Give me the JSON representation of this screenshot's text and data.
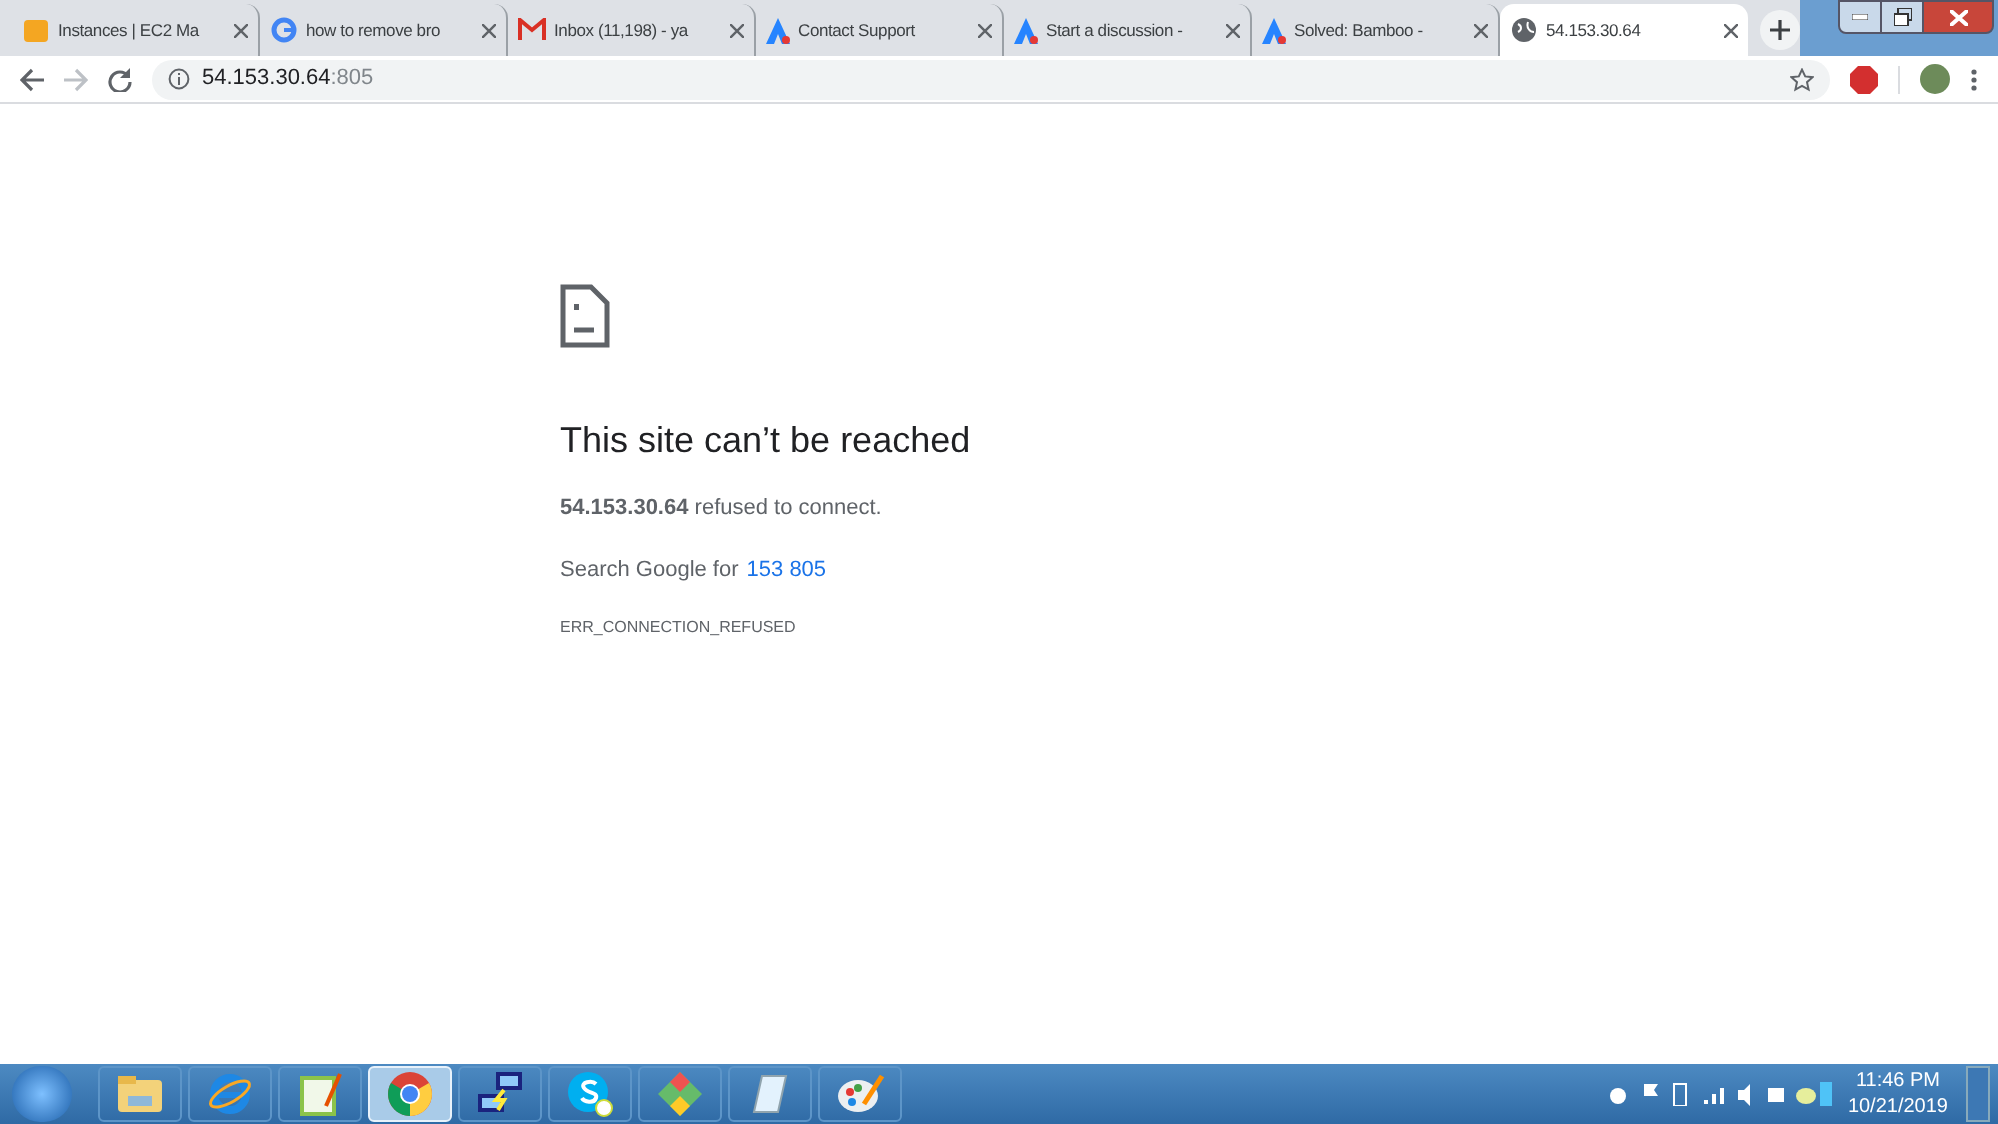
{
  "tabs": [
    {
      "title": "Instances | EC2 Ma",
      "kind": "box",
      "selected": false
    },
    {
      "title": "how to remove bro",
      "kind": "google",
      "selected": false
    },
    {
      "title": "Inbox (11,198) - ya",
      "kind": "mail",
      "selected": false
    },
    {
      "title": "Contact Support",
      "kind": "peak",
      "selected": false
    },
    {
      "title": "Start a discussion -",
      "kind": "peak",
      "selected": false
    },
    {
      "title": "Solved: Bamboo -",
      "kind": "peak",
      "selected": false
    },
    {
      "title": "54.153.30.64",
      "kind": "globe",
      "selected": true
    }
  ],
  "address": {
    "host": "54.153.30.64",
    "port": ":805"
  },
  "error": {
    "title": "This site can’t be reached",
    "message": "**54.153.30.64** refused to connect.",
    "search_prefix": "Search Google for",
    "search_link": "153 805",
    "code": "ERR_CONNECTION_REFUSED"
  },
  "taskbar": [
    {
      "kind": "folder",
      "selected": false
    },
    {
      "kind": "ie",
      "selected": false
    },
    {
      "kind": "notepadpp",
      "selected": false
    },
    {
      "kind": "chrome",
      "selected": true
    },
    {
      "kind": "network",
      "selected": false
    },
    {
      "kind": "skype",
      "selected": false
    },
    {
      "kind": "diamond",
      "selected": false
    },
    {
      "kind": "notepad",
      "selected": false
    },
    {
      "kind": "paint",
      "selected": false
    }
  ],
  "clock": {
    "time": "11:46 PM",
    "date": "10/21/2019"
  }
}
